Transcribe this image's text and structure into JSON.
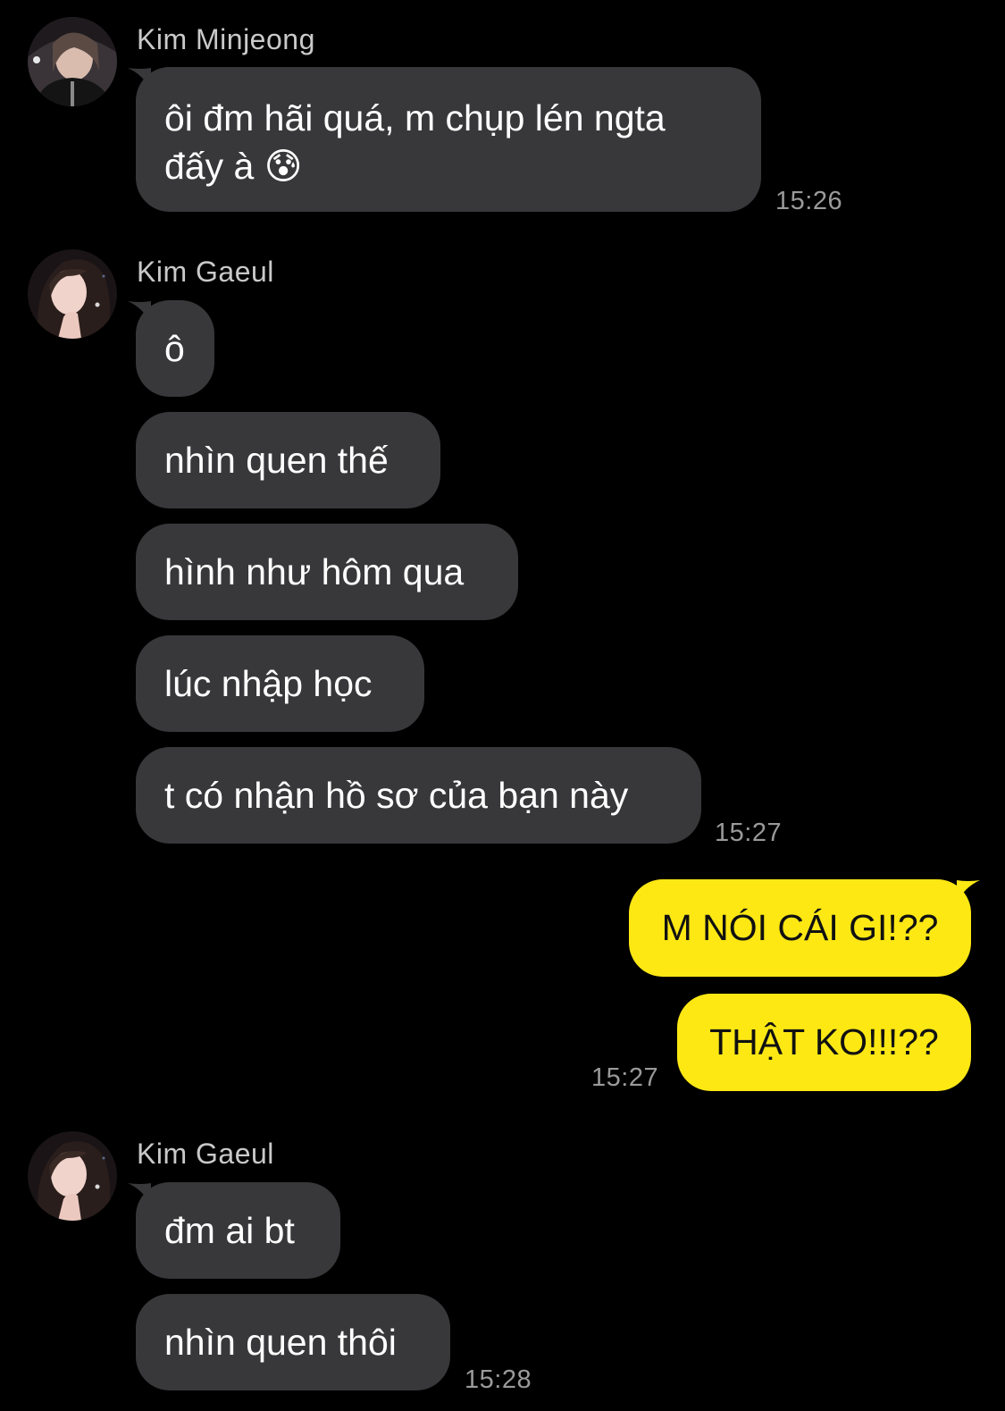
{
  "colors": {
    "background": "#000000",
    "incoming_bubble": "#38383a",
    "outgoing_bubble": "#fde814",
    "sender_name": "#c9c9c9",
    "timestamp": "#9a9a9a"
  },
  "groups": [
    {
      "sender": "Kim Minjeong",
      "avatar": "avatar-minjeong",
      "messages": [
        {
          "line1": "ôi đm hãi quá, m chụp lén ngta",
          "line2": "đấy à",
          "emoji": "😰"
        }
      ],
      "time": "15:26"
    },
    {
      "sender": "Kim Gaeul",
      "avatar": "avatar-gaeul",
      "messages": [
        {
          "text": "ô"
        },
        {
          "text": "nhìn quen thế"
        },
        {
          "text": "hình như hôm qua"
        },
        {
          "text": "lúc nhập học"
        },
        {
          "text": "t có nhận hồ sơ của bạn này"
        }
      ],
      "time": "15:27"
    },
    {
      "sender": "me",
      "messages": [
        {
          "text": "M NÓI CÁI GI!??"
        },
        {
          "text": "THẬT KO!!!??"
        }
      ],
      "time": "15:27"
    },
    {
      "sender": "Kim Gaeul",
      "avatar": "avatar-gaeul",
      "messages": [
        {
          "text": "đm ai bt"
        },
        {
          "text": "nhìn quen thôi"
        }
      ],
      "time": "15:28"
    }
  ]
}
